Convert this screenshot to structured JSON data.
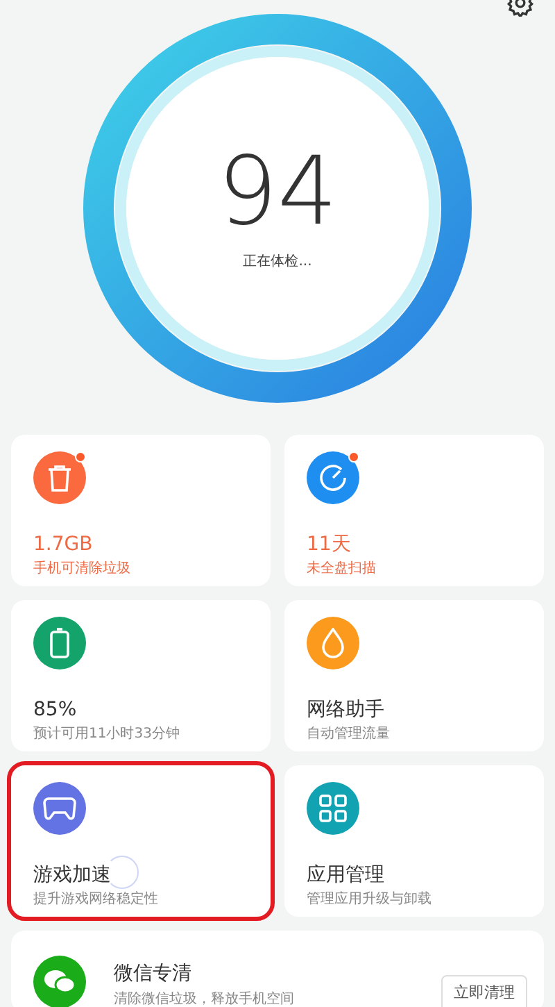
{
  "score": {
    "value": "94",
    "status": "正在体检..."
  },
  "cards": [
    {
      "title": "1.7GB",
      "subtitle": "手机可清除垃圾",
      "color": "#fb6a3e",
      "alert": true,
      "highlighted": false,
      "loading": false
    },
    {
      "title": "11天",
      "subtitle": "未全盘扫描",
      "color": "#1e8ef0",
      "alert": true,
      "highlighted": false,
      "loading": false
    },
    {
      "title": "85%",
      "subtitle": "预计可用11小时33分钟",
      "color": "#14a36b",
      "alert": false,
      "highlighted": false,
      "loading": false
    },
    {
      "title": "网络助手",
      "subtitle": "自动管理流量",
      "color": "#fb9a1c",
      "alert": false,
      "highlighted": false,
      "loading": false
    },
    {
      "title": "游戏加速",
      "subtitle": "提升游戏网络稳定性",
      "color": "#6373e4",
      "alert": false,
      "highlighted": true,
      "loading": true
    },
    {
      "title": "应用管理",
      "subtitle": "管理应用升级与卸载",
      "color": "#12a3b2",
      "alert": false,
      "highlighted": false,
      "loading": false
    }
  ],
  "wechat": {
    "title": "微信专清",
    "subtitle": "清除微信垃圾，释放手机空间",
    "button": "立即清理"
  }
}
